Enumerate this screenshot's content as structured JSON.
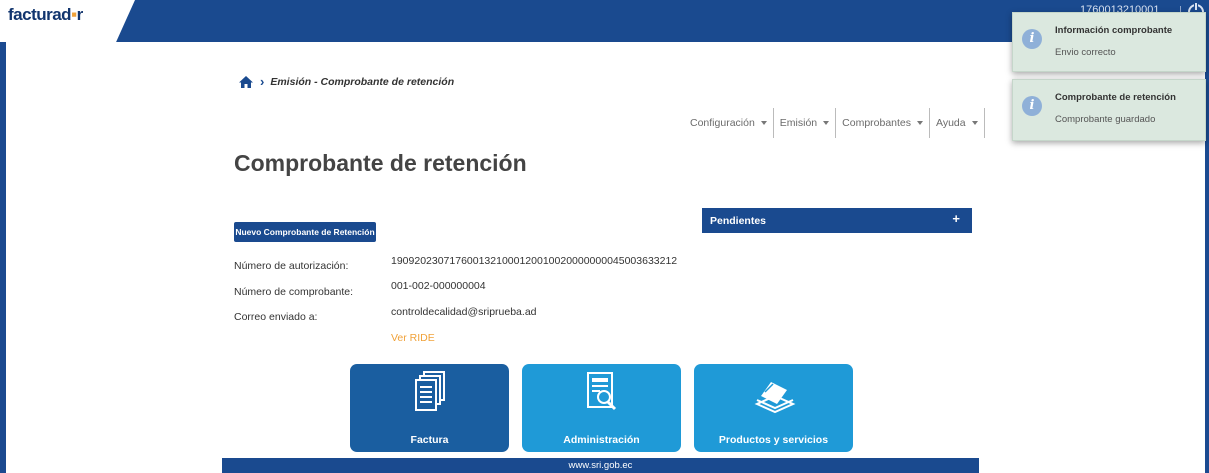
{
  "header": {
    "logo_text_a": "facturad",
    "logo_text_b": "r",
    "user_id": "1760013210001"
  },
  "breadcrumb": {
    "text": "Emisión - Comprobante de retención"
  },
  "menu": {
    "items": [
      "Configuración",
      "Emisión",
      "Comprobantes",
      "Ayuda"
    ]
  },
  "page": {
    "title": "Comprobante de retención",
    "new_button": "Nuevo Comprobante de Retención"
  },
  "pending": {
    "title": "Pendientes",
    "plus": "+"
  },
  "details": {
    "auth_label": "Número de autorización:",
    "auth_value": "1909202307176001321000120010020000000045003633212",
    "number_label": "Número de comprobante:",
    "number_value": "001-002-000000004",
    "email_label": "Correo enviado a:",
    "email_value": "controldecalidad@sriprueba.ad",
    "ride_link": "Ver RIDE"
  },
  "tiles": {
    "factura": "Factura",
    "admin": "Administración",
    "products": "Productos y servicios"
  },
  "footer": {
    "url": "www.sri.gob.ec"
  },
  "notifications": [
    {
      "title": "Información comprobante",
      "message": "Envio correcto"
    },
    {
      "title": "Comprobante de retención",
      "message": "Comprobante guardado"
    }
  ],
  "colors": {
    "brand_blue": "#1a4a8f",
    "tile_dark": "#1a5ea0",
    "tile_light": "#1f9ad7",
    "link_orange": "#f0a23a"
  }
}
